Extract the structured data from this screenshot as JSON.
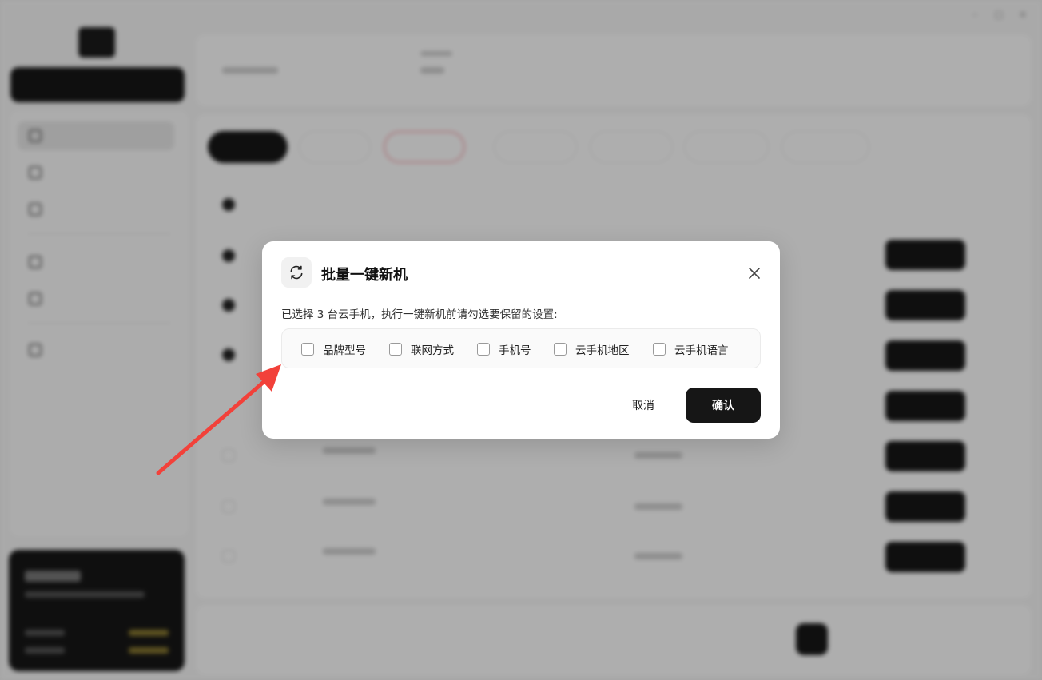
{
  "dialog": {
    "title": "批量一键新机",
    "description": "已选择 3 台云手机，执行一键新机前请勾选要保留的设置:",
    "options": [
      {
        "label": "品牌型号",
        "checked": false
      },
      {
        "label": "联网方式",
        "checked": false
      },
      {
        "label": "手机号",
        "checked": false
      },
      {
        "label": "云手机地区",
        "checked": false
      },
      {
        "label": "云手机语言",
        "checked": false
      }
    ],
    "cancel_label": "取消",
    "confirm_label": "确认",
    "icon": "refresh-icon",
    "close_icon": "close-icon"
  },
  "annotation": {
    "arrow_color": "#f2413a"
  },
  "colors": {
    "primary_button": "#161616",
    "overlay": "rgba(0,0,0,0.30)"
  }
}
